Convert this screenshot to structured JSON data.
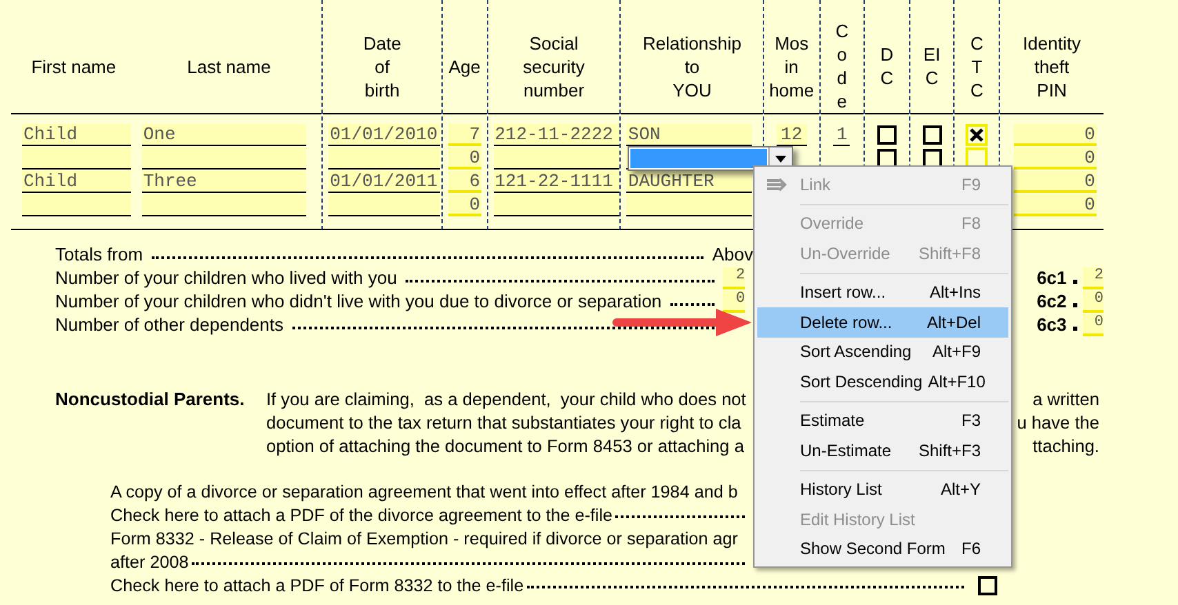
{
  "table": {
    "columns": [
      {
        "label": "First name"
      },
      {
        "label": "Last name"
      },
      {
        "label": "Date\nof\nbirth"
      },
      {
        "label": "Age"
      },
      {
        "label": "Social\nsecurity\nnumber"
      },
      {
        "label": "Relationship\nto\nYOU"
      },
      {
        "label": "Mos\nin\nhome"
      },
      {
        "label": "Code"
      },
      {
        "label": "DC"
      },
      {
        "label": "EIC"
      },
      {
        "label": "CTC"
      },
      {
        "label": "Identity\ntheft\nPIN"
      }
    ],
    "rows": [
      {
        "first": "Child",
        "last": "One",
        "dob": "01/01/2010",
        "age": "7",
        "ssn": "212-11-2222",
        "relationship": "SON",
        "months": "12",
        "code": "1",
        "dc": false,
        "eic": false,
        "ctc": true,
        "pin": "0"
      },
      {
        "age": "0",
        "relationship_editing": true,
        "dc": false,
        "eic": false,
        "ctc": false,
        "pin": "0"
      },
      {
        "first": "Child",
        "last": "Three",
        "dob": "01/01/2011",
        "age": "6",
        "ssn": "121-22-1111",
        "relationship": "DAUGHTER",
        "pin": "0"
      },
      {
        "age": "0",
        "pin": "0"
      }
    ]
  },
  "totals": {
    "label": "Totals from",
    "column_label": "Abov",
    "lines": [
      {
        "label": "Number of your children who lived with you",
        "left_value": "2",
        "line": "6c1",
        "value": "2"
      },
      {
        "label": "Number of your children who didn't live with you due to divorce or separation",
        "left_value": "0",
        "line": "6c2",
        "value": "0"
      },
      {
        "label": "Number of other dependents",
        "line": "6c3",
        "value": "0"
      }
    ]
  },
  "noncustodial": {
    "heading": "Noncustodial Parents.",
    "lines": [
      {
        "left": "If you are claiming,  as a dependent,  your child who does not",
        "right": "a written"
      },
      {
        "left": "document to the tax return that substantiates your right to cla",
        "right": "u have the"
      },
      {
        "left": "option of attaching the document to Form 8453 or attaching a",
        "right": "ttaching."
      }
    ]
  },
  "attachments": [
    {
      "text": "A copy of a divorce or separation agreement that went into effect after 1984 and b"
    },
    {
      "text": "Check here to attach a PDF of the divorce agreement to the e-file",
      "leader": true
    },
    {
      "text": "Form 8332 - Release of Claim of Exemption - required if divorce or separation agr"
    },
    {
      "text": "after 2008",
      "leader": true
    },
    {
      "text": "Check here to attach a PDF of Form 8332 to the e-file",
      "leader": true,
      "checked": false
    }
  ],
  "context_menu": {
    "groups": [
      [
        {
          "label": "Link",
          "shortcut": "F9",
          "disabled": true,
          "selected": false,
          "icon": true
        }
      ],
      [
        {
          "label": "Override",
          "shortcut": "F8",
          "disabled": true,
          "selected": false
        },
        {
          "label": "Un-Override",
          "shortcut": "Shift+F8",
          "disabled": true,
          "selected": false
        }
      ],
      [
        {
          "label": "Insert row...",
          "shortcut": "Alt+Ins",
          "disabled": false,
          "selected": false
        },
        {
          "label": "Delete row...",
          "shortcut": "Alt+Del",
          "disabled": false,
          "selected": true
        },
        {
          "label": "Sort Ascending",
          "shortcut": "Alt+F9",
          "disabled": false,
          "selected": false
        },
        {
          "label": "Sort Descending",
          "shortcut": "Alt+F10",
          "disabled": false,
          "selected": false
        }
      ],
      [
        {
          "label": "Estimate",
          "shortcut": "F3",
          "disabled": false,
          "selected": false
        },
        {
          "label": "Un-Estimate",
          "shortcut": "Shift+F3",
          "disabled": false,
          "selected": false
        }
      ],
      [
        {
          "label": "History List",
          "shortcut": "Alt+Y",
          "disabled": false,
          "selected": false
        },
        {
          "label": "Edit History List",
          "disabled": true,
          "selected": false
        },
        {
          "label": "Show Second Form",
          "shortcut": "F6",
          "disabled": false,
          "selected": false
        }
      ]
    ]
  }
}
